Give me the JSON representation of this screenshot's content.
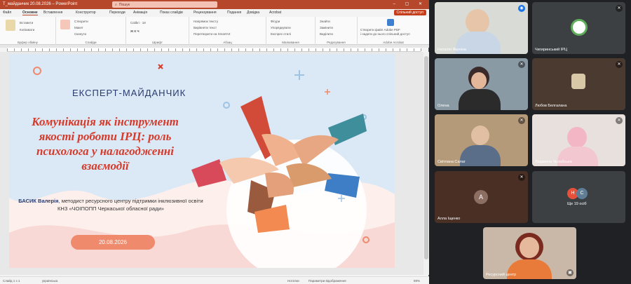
{
  "window": {
    "title": "Т_майданчик 20.08.2026 – PowerPoint",
    "search_placeholder": "Пошук",
    "controls": "– ▢ ✕"
  },
  "menu": {
    "items": [
      "Файл",
      "Основне",
      "Вставлення",
      "Конструктор",
      "Переходи",
      "Анімація",
      "Показ слайдів",
      "Рецензування",
      "Подання",
      "Довідка",
      "Acrobat"
    ],
    "share_label": "Спільний доступ"
  },
  "ribbon": {
    "groups": [
      {
        "label": "Буфер обміну",
        "lines": [
          "Вставити",
          "Копіювати"
        ]
      },
      {
        "label": "Слайди",
        "lines": [
          "Створити",
          "Макет",
          "Скинути"
        ]
      },
      {
        "label": "Шрифт",
        "lines": [
          "Calibri · 18",
          "Ж К Ч"
        ]
      },
      {
        "label": "Абзац",
        "lines": [
          "Напрямок тексту",
          "Вирівняти текст",
          "Перетворити на SmartArt"
        ]
      },
      {
        "label": "Малювання",
        "lines": [
          "Фігури",
          "Упорядкувати",
          "Експрес-стилі"
        ]
      },
      {
        "label": "Редагування",
        "lines": [
          "Знайти",
          "Замінити",
          "Виділити"
        ]
      },
      {
        "label": "Adobe Acrobat",
        "lines": [
          "Створити файл Adobe PDF",
          "і надати до нього спільний доступ"
        ]
      }
    ]
  },
  "slide": {
    "label": "ЕКСПЕРТ-МАЙДАНЧИК",
    "title": "Комунікація як інструмент якості роботи ІРЦ: роль психолога у налагодженні взаємодії",
    "author_name": "БАСИК Валерія",
    "author_desc": ", методист ресурсного центру підтримки інклюзивної освіти КНЗ «ЧОІПОПП Черкаської обласної ради»",
    "date": "20.08.2026",
    "colors": {
      "accent": "#d63a2a",
      "navy": "#2a3b6e",
      "date_bg": "#f08a6c",
      "blue_blob": "#dbe8f5",
      "pink_blob": "#f8d9d6"
    }
  },
  "status": {
    "left": "Слайд 1 з 1",
    "lang": "українська",
    "notes": "Нотатки",
    "display": "Параметри відображення",
    "zoom": "59%"
  },
  "participants": [
    {
      "name": "Наталія Якуніна",
      "initials": "",
      "color": "#d9dcd6",
      "muted": false
    },
    {
      "name": "Чигиринський ІРЦ",
      "initials": "",
      "color": "#3c4043",
      "muted": true
    },
    {
      "name": "Олена",
      "initials": "",
      "color": "#8a9aa4",
      "muted": true
    },
    {
      "name": "Любов Белгалана",
      "initials": "",
      "color": "#4a3a30",
      "muted": true
    },
    {
      "name": "Світлана Салаг",
      "initials": "",
      "color": "#b59a7a",
      "muted": true
    },
    {
      "name": "Людмила Чолабська",
      "initials": "",
      "color": "#e8e0dc",
      "muted": true
    },
    {
      "name": "Алла Іщенко",
      "initials": "А",
      "color": "#4a2f24",
      "muted": true
    },
    {
      "name": "Ще 19 осіб",
      "initials": "Н",
      "initials2": "С",
      "color": "#3c4043",
      "muted": false
    },
    {
      "name": "Ресурсний центр",
      "initials": "",
      "color": "#c9b8a8",
      "muted": false
    }
  ]
}
